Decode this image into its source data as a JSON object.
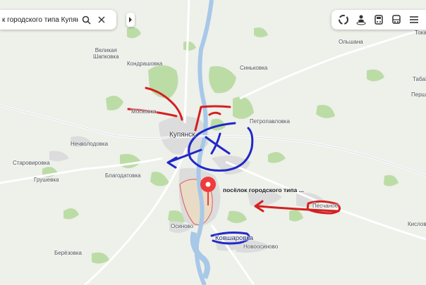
{
  "search": {
    "value": "к городского типа Купянск-Уз"
  },
  "pin": {
    "label": "посёлок городского типа ..."
  },
  "places": {
    "velikaya_shapkovka": "Великая\nШапковка",
    "kondrashovka": "Кондрашовка",
    "sinkovka": "Синьковка",
    "olshana": "Ольшана",
    "moskovka": "Москoвка",
    "petropavlovka": "Петропавловка",
    "kupyansk": "Купянск",
    "nechvolodovka": "Нечволодовка",
    "starovirovka": "Старовировка",
    "blagodatovka": "Благодатовка",
    "grushevka": "Грушевка",
    "peschanoe": "Песчаное",
    "osinovo": "Осиново",
    "kovsharovka": "Ковшаровка",
    "novoosinovo": "Новоосиново",
    "berezovka": "Берёзовка",
    "tokar": "Токар",
    "tabaev": "Табаїв",
    "persh": "Перш",
    "kislov": "Кислов"
  },
  "colors": {
    "water": "#a8c8e8",
    "forest": "#b9dca2",
    "urban": "#dcdcdc",
    "road": "#ffffff",
    "red_arrow": "#d42020",
    "blue_arrow": "#2028c8",
    "pin": "#ef3b3b"
  },
  "icons": [
    "search-icon",
    "close-icon",
    "chevron-right-icon",
    "layers-icon",
    "panorama-icon",
    "traffic-icon",
    "transport-icon",
    "menu-icon"
  ]
}
